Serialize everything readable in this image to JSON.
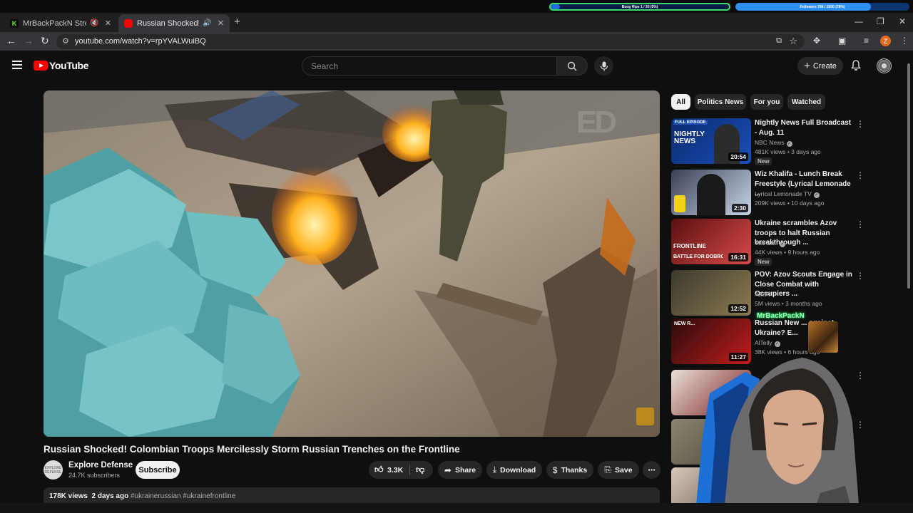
{
  "stream_overlay": {
    "goal_1": {
      "label": "Bong Rips 1 / 30 (5%)",
      "progress": 0.05
    },
    "goal_2": {
      "label": "Followers 784 / 1000 (78%)",
      "progress": 0.78
    }
  },
  "browser": {
    "tabs": [
      {
        "title": "MrBackPackN Stream - Wa",
        "favicon_letter": "K",
        "favicon_color": "#53fc18",
        "muted": true
      },
      {
        "title": "Russian Shocked! Colombia",
        "favicon_color": "#ff0000",
        "muted": false,
        "active": true
      }
    ],
    "new_tab_glyph": "+",
    "url": "youtube.com/watch?v=rpYVALWuiBQ",
    "profile_initial": "Z"
  },
  "youtube": {
    "logo_text": "YouTube",
    "search_placeholder": "Search",
    "create_label": "Create"
  },
  "video": {
    "title": "Russian Shocked! Colombian Troops Mercilessly Storm Russian Trenches on the Frontline",
    "watermark": "ED",
    "channel": {
      "name": "Explore Defense",
      "subscribers": "24.7K subscribers",
      "avatar_text": "EXPLORE DEFENSE"
    },
    "subscribe_label": "Subscribe",
    "likes": "3.3K",
    "actions": {
      "share": "Share",
      "download": "Download",
      "thanks": "Thanks",
      "save": "Save"
    },
    "views": "178K views",
    "date": "2 days ago",
    "hashtags": "#ukrainerussian #ukrainefrontline"
  },
  "sidebar": {
    "chips": [
      "All",
      "Politics News",
      "For you",
      "Watched"
    ],
    "active_chip": 0,
    "recommendations": [
      {
        "title": "Nightly News Full Broadcast - Aug. 11",
        "channel": "NBC News",
        "verified": true,
        "meta": "481K views • 3 days ago",
        "duration": "20:54",
        "badge": "New",
        "thumb_overlay": "NIGHTLY NEWS",
        "thumb_top_label": "FULL EPISODE",
        "thumb_colors": [
          "#0a2a6e",
          "#1b4fb8"
        ]
      },
      {
        "title": "Wiz Khalifa - Lunch Break Freestyle (Lyrical Lemonade ...",
        "channel": "Lyrical Lemonade TV",
        "verified": true,
        "meta": "209K views • 10 days ago",
        "duration": "2:30",
        "thumb_colors": [
          "#3a3f55",
          "#c9d6e8"
        ]
      },
      {
        "title": "Ukraine scrambles Azov troops to halt Russian breakthrough ...",
        "channel": "The Sun",
        "verified": true,
        "meta": "44K views • 9 hours ago",
        "duration": "16:31",
        "badge": "New",
        "thumb_overlay": "BATTLE FOR DOBROPILLIA",
        "thumb_top_label": "FRONTLINE",
        "thumb_colors": [
          "#5a1010",
          "#d84a4a"
        ]
      },
      {
        "title": "POV: Azov Scouts Engage in Close Combat with Occupiers ...",
        "channel": "AZOV",
        "verified": false,
        "meta": "5M views • 3 months ago",
        "duration": "12:52",
        "thumb_colors": [
          "#3c3a2c",
          "#8b7a52"
        ]
      },
      {
        "title": "Russian New ... against Ukraine? E...",
        "channel": "AlTelly",
        "verified": true,
        "meta": "38K views • 6 hours ago",
        "duration": "11:27",
        "thumb_overlay": "NEW R...",
        "thumb_colors": [
          "#2a0b0b",
          "#c21d1d"
        ]
      }
    ]
  },
  "stream_alert": "MrBackPackN"
}
